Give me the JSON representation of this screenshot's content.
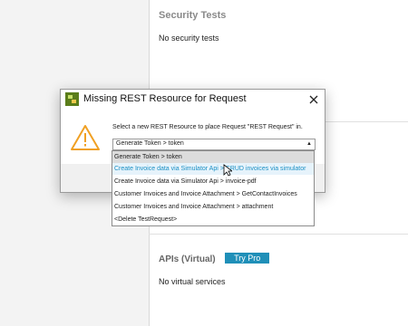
{
  "background": {
    "security_section": {
      "title": "Security Tests",
      "text": "No security tests"
    },
    "apis_section": {
      "title": "APIs (Virtual)",
      "try_pro_label": "Try Pro",
      "text": "No virtual services"
    }
  },
  "dialog": {
    "title": "Missing REST Resource for Request",
    "prompt": "Select a new REST Resource to place Request \"REST Request\" in.",
    "combo_value": "Generate Token > token",
    "combo_arrow": "▲",
    "icon": "warning-triangle-icon",
    "accent_color": "#f0a023"
  },
  "dropdown": {
    "items": [
      "Generate Token > token",
      "Create Invoice data via Simulator Api > CRUD invoices via simulator",
      "Create Invoice data via Simulator Api > invoice-pdf",
      "Customer Invoices and Invoice Attachment > GetContactInvoices",
      "Customer Invoices and Invoice Attachment > attachment",
      "<Delete TestRequest>"
    ],
    "selected_index": 0,
    "hover_index": 1,
    "hover_color": "#1b8fc4"
  },
  "colors": {
    "try_pro": "#1f8fb8",
    "panel_bg": "#ffffff",
    "app_bg": "#f3f3f3"
  }
}
